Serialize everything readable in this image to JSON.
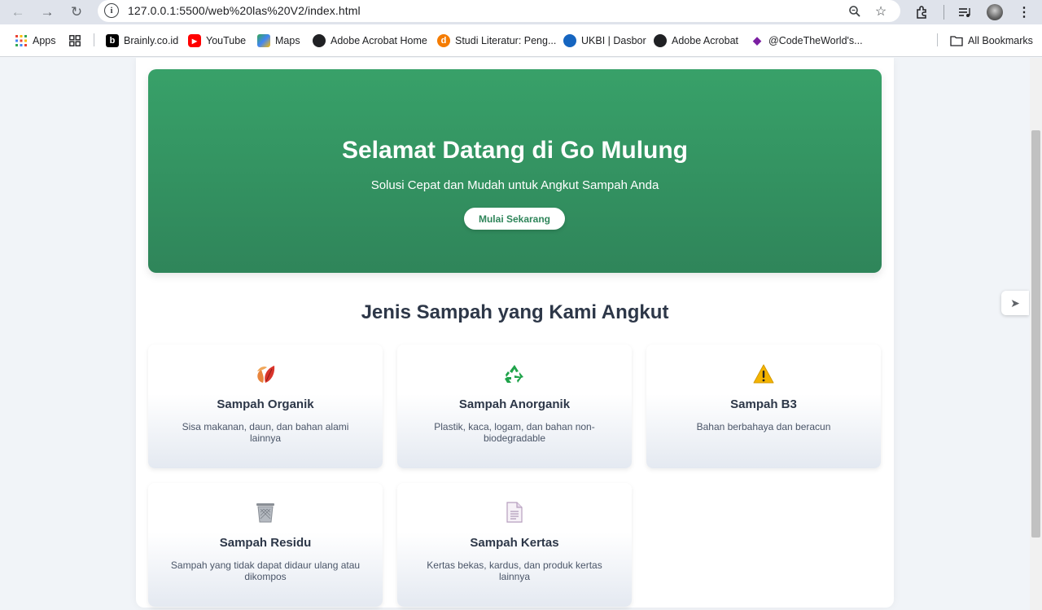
{
  "browser": {
    "url": "127.0.0.1:5500/web%20las%20V2/index.html",
    "bookmarks": [
      {
        "label": "Apps",
        "icon": "apps-grid-icon"
      },
      {
        "label": "Brainly.co.id",
        "icon": "brainly-icon"
      },
      {
        "label": "YouTube",
        "icon": "youtube-icon"
      },
      {
        "label": "Maps",
        "icon": "maps-icon"
      },
      {
        "label": "Adobe Acrobat Home",
        "icon": "globe-icon"
      },
      {
        "label": "Studi Literatur: Peng...",
        "icon": "studi-icon"
      },
      {
        "label": "UKBI | Dasbor",
        "icon": "ukbi-icon"
      },
      {
        "label": "Adobe Acrobat",
        "icon": "globe-icon"
      },
      {
        "label": "@CodeTheWorld's...",
        "icon": "code-icon"
      }
    ],
    "all_bookmarks": "All Bookmarks"
  },
  "hero": {
    "title": "Selamat Datang di Go Mulung",
    "subtitle": "Solusi Cepat dan Mudah untuk Angkut Sampah Anda",
    "cta": "Mulai Sekarang",
    "gradient_top": "#38a169",
    "gradient_bottom": "#2f855a"
  },
  "section": {
    "title": "Jenis Sampah yang Kami Angkut",
    "cards": [
      {
        "title": "Sampah Organik",
        "desc": "Sisa makanan, daun, dan bahan alami lainnya",
        "icon": "leaves-icon"
      },
      {
        "title": "Sampah Anorganik",
        "desc": "Plastik, kaca, logam, dan bahan non-biodegradable",
        "icon": "recycle-icon"
      },
      {
        "title": "Sampah B3",
        "desc": "Bahan berbahaya dan beracun",
        "icon": "warning-icon"
      },
      {
        "title": "Sampah Residu",
        "desc": "Sampah yang tidak dapat didaur ulang atau dikompos",
        "icon": "trash-bin-icon"
      },
      {
        "title": "Sampah Kertas",
        "desc": "Kertas bekas, kardus, dan produk kertas lainnya",
        "icon": "document-icon"
      }
    ]
  }
}
